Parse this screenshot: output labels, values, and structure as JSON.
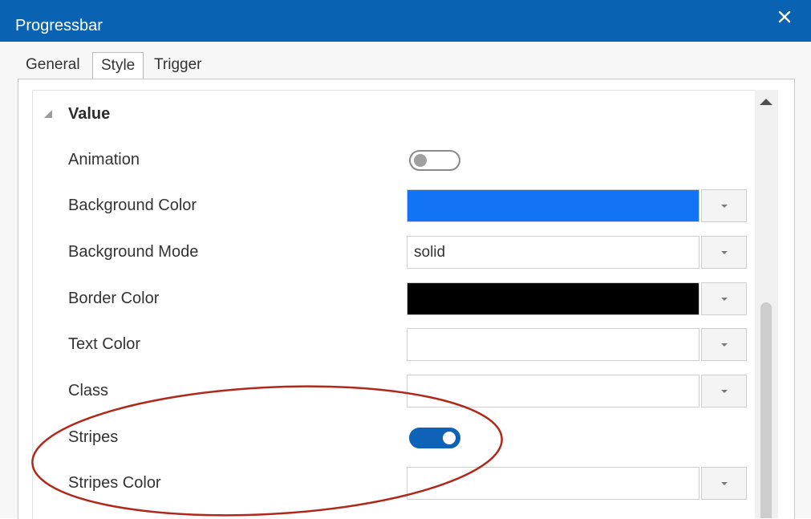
{
  "window": {
    "title": "Progressbar",
    "close_icon": "close-icon"
  },
  "tabs": [
    {
      "label": "General",
      "active": false
    },
    {
      "label": "Style",
      "active": true
    },
    {
      "label": "Trigger",
      "active": false
    }
  ],
  "section": {
    "label": "Value",
    "expanded": true,
    "icon": "collapse-triangle-icon"
  },
  "properties": [
    {
      "label": "Animation",
      "type": "toggle",
      "on": false
    },
    {
      "label": "Background Color",
      "type": "color",
      "color": "#1273f5"
    },
    {
      "label": "Background Mode",
      "type": "select",
      "value": "solid"
    },
    {
      "label": "Border Color",
      "type": "color",
      "color": "#000000"
    },
    {
      "label": "Text Color",
      "type": "color",
      "color": "#ffffff"
    },
    {
      "label": "Class",
      "type": "color",
      "color": "#ffffff"
    },
    {
      "label": "Stripes",
      "type": "toggle",
      "on": true
    },
    {
      "label": "Stripes Color",
      "type": "color",
      "color": "#ffffff"
    }
  ],
  "colors": {
    "titlebar": "#0a62b3",
    "toggle_on": "#0e63b8",
    "annotation": "#b0281a"
  }
}
